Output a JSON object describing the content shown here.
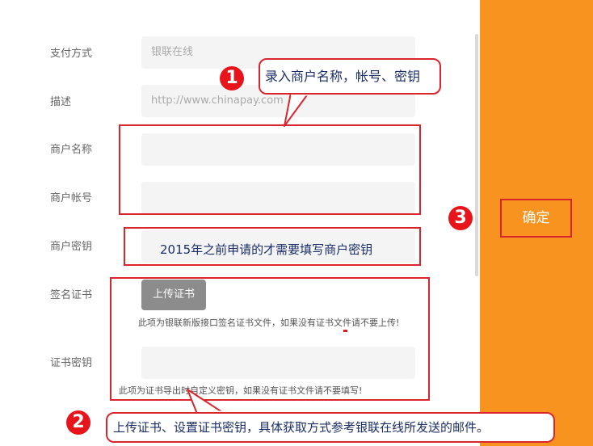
{
  "form": {
    "payment_method": {
      "label": "支付方式",
      "value": "银联在线"
    },
    "description": {
      "label": "描述",
      "value": "http://www.chinapay.com"
    },
    "merchant_name": {
      "label": "商户名称",
      "value": ""
    },
    "merchant_account": {
      "label": "商户帐号",
      "value": ""
    },
    "merchant_key": {
      "label": "商户密钥",
      "value": ""
    },
    "sign_cert": {
      "label": "签名证书",
      "button_label": "上传证书",
      "hint": "此项为银联新版接口签名证书文件，如果没有证书文件请不要上传!"
    },
    "cert_password": {
      "label": "证书密钥",
      "value": "",
      "hint": "此项为证书导出时自定义密钥，如果没有证书文件请不要填写!"
    }
  },
  "confirm_button": {
    "label": "确定"
  },
  "annotations": {
    "badge1": "1",
    "badge2": "2",
    "badge3": "3",
    "callout1": "录入商户名称，帐号、密钥",
    "callout_key": "2015年之前申请的才需要填写商户密钥",
    "callout2": "上传证书、设置证书密钥，具体获取方式参考银联在线所发送的邮件。"
  },
  "colors": {
    "accent": "#f7931e",
    "annotation_red": "#d9262c",
    "badge_red": "#e8141b",
    "callout_text": "#1b2e66"
  }
}
